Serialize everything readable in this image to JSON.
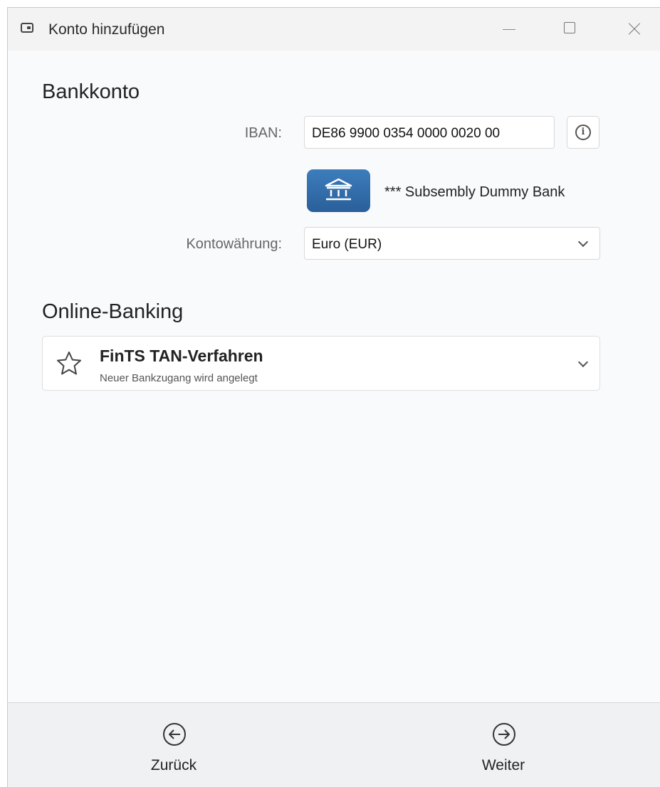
{
  "window": {
    "title": "Konto hinzufügen"
  },
  "bank_account": {
    "heading": "Bankkonto",
    "iban_label": "IBAN:",
    "iban_value": "DE86 9900 0354 0000 0020 00",
    "bank_name": "*** Subsembly Dummy Bank",
    "currency_label": "Kontowährung:",
    "currency_value": "Euro (EUR)"
  },
  "online_banking": {
    "heading": "Online-Banking",
    "method_title": "FinTS TAN-Verfahren",
    "method_subtitle": "Neuer Bankzugang wird angelegt"
  },
  "footer": {
    "back_label": "Zurück",
    "next_label": "Weiter"
  },
  "colors": {
    "accent": "#2e6aa8",
    "background": "#f9fafc"
  },
  "icons": [
    "app-window-icon",
    "minimize-icon",
    "maximize-icon",
    "close-icon",
    "info-icon",
    "bank-icon",
    "chevron-down-icon",
    "star-icon",
    "arrow-left-circle-icon",
    "arrow-right-circle-icon"
  ]
}
